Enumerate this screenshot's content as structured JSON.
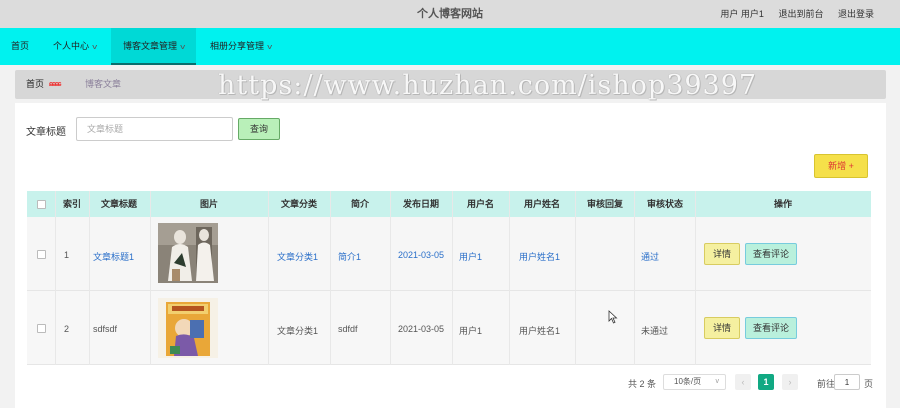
{
  "header": {
    "site_title": "个人博客网站",
    "user_label": "用户 用户1",
    "to_front": "退出到前台",
    "logout": "退出登录"
  },
  "nav": {
    "items": [
      {
        "label": "首页",
        "has_dropdown": false
      },
      {
        "label": "个人中心",
        "has_dropdown": true
      },
      {
        "label": "博客文章管理",
        "has_dropdown": true,
        "active": true
      },
      {
        "label": "相册分享管理",
        "has_dropdown": true
      }
    ]
  },
  "breadcrumb": {
    "home": "首页",
    "separator": "ɕɕɕɕ",
    "current": "博客文章"
  },
  "watermark": "https://www.huzhan.com/ishop39397",
  "search": {
    "label": "文章标题",
    "placeholder": "文章标题",
    "value": "",
    "button": "查询"
  },
  "actions": {
    "new_button": "新增 +"
  },
  "table": {
    "columns": [
      "索引",
      "文章标题",
      "图片",
      "文章分类",
      "简介",
      "发布日期",
      "用户名",
      "用户姓名",
      "审核回复",
      "审核状态",
      "操作"
    ],
    "rows": [
      {
        "index": "1",
        "title": "文章标题1",
        "category": "文章分类1",
        "summary": "简介1",
        "date": "2021-03-05",
        "username": "用户1",
        "realname": "用户姓名1",
        "reply": "",
        "status": "通过",
        "detail_btn": "详情",
        "comments_btn": "查看评论"
      },
      {
        "index": "2",
        "title": "sdfsdf",
        "category": "文章分类1",
        "summary": "sdfdf",
        "date": "2021-03-05",
        "username": "用户1",
        "realname": "用户姓名1",
        "reply": "",
        "status": "未通过",
        "detail_btn": "详情",
        "comments_btn": "查看评论"
      }
    ]
  },
  "pagination": {
    "total": "共 2 条",
    "page_size": "10条/页",
    "prev": "‹",
    "current_page": "1",
    "next": "›",
    "goto_label": "前往",
    "goto_value": "1",
    "unit": "页"
  },
  "colors": {
    "nav_bg": "#00f2ef",
    "header_bg": "#dcdcdc",
    "table_header_bg": "#c8f2ec",
    "page_active": "#11a983"
  }
}
